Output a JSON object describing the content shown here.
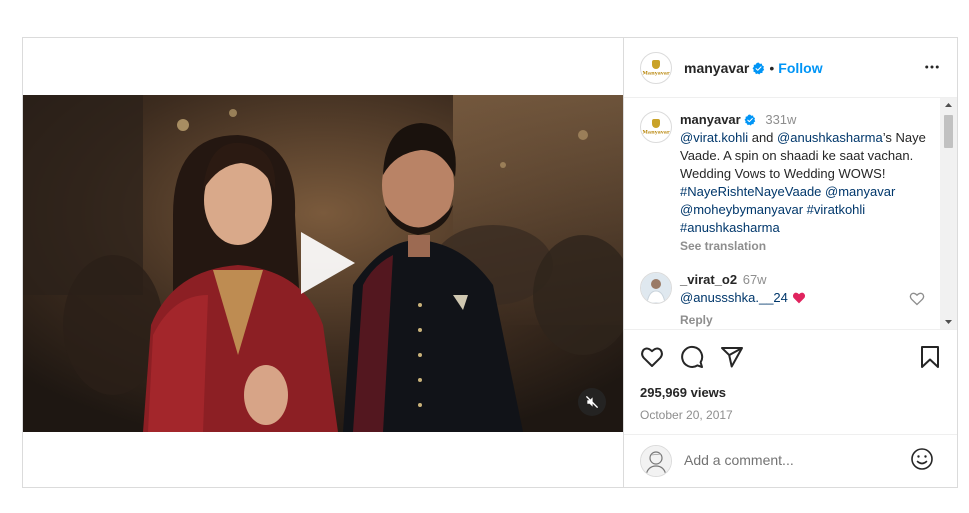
{
  "post": {
    "username": "manyavar",
    "follow_label": "Follow",
    "dot": "•",
    "more_icon": "more-horizontal-icon",
    "brand_logo_text": "Manyavar"
  },
  "video": {
    "play_icon": "play-icon",
    "mute_icon": "muted-speaker-icon"
  },
  "caption": {
    "username": "manyavar",
    "time": "331w",
    "mention1": "@virat.kohli",
    "and": " and ",
    "mention2": "@anushkasharma",
    "text1": "’s Naye Vaade. A spin on shaadi ke saat vachan. Wedding Vows to Wedding WOWS! ",
    "tag1": "#NayeRishteNayeVaade",
    "mention3": "@manyavar",
    "mention4": "@moheybymanyavar",
    "tag2": "#viratkohli",
    "tag3": "#anushkasharma",
    "see_translation": "See translation"
  },
  "comment": {
    "username": "_virat_o2",
    "time": "67w",
    "mention": "@anussshka.__24",
    "emoji": "❤️",
    "reply_label": "Reply",
    "like_icon": "heart-outline-icon"
  },
  "actions": {
    "like_icon": "heart-icon",
    "comment_icon": "comment-icon",
    "share_icon": "share-icon",
    "save_icon": "bookmark-icon",
    "views": "295,969 views",
    "date": "October 20, 2017"
  },
  "add_comment": {
    "placeholder": "Add a comment...",
    "emoji_icon": "smiley-icon"
  },
  "colors": {
    "accent": "#0095f6",
    "verified": "#0095f6",
    "heart_emoji": "#e0245e",
    "link": "#00376b",
    "muted": "#8e8e8e"
  }
}
